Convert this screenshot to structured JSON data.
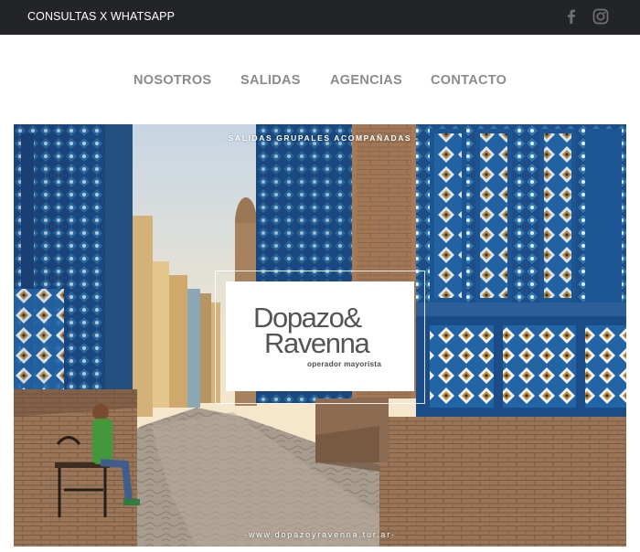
{
  "topbar": {
    "whatsapp_label": "CONSULTAS X WHATSAPP",
    "social": [
      {
        "icon": "facebook-icon"
      },
      {
        "icon": "instagram-icon"
      }
    ]
  },
  "nav": {
    "items": [
      {
        "label": "NOSOTROS"
      },
      {
        "label": "SALIDAS"
      },
      {
        "label": "AGENCIAS"
      },
      {
        "label": "CONTACTO"
      }
    ]
  },
  "hero": {
    "tagline": "- SALIDAS GRUPALES ACOMPAÑADAS -",
    "logo": {
      "line1": "Dopazo&",
      "line2": "Ravenna",
      "subtitle": "operador mayorista"
    },
    "url": "-www.dopazoyravenna.tur.ar-"
  },
  "colors": {
    "topbar_bg": "#232427",
    "nav_text": "#8b8b8b",
    "logo_text": "#555557"
  }
}
